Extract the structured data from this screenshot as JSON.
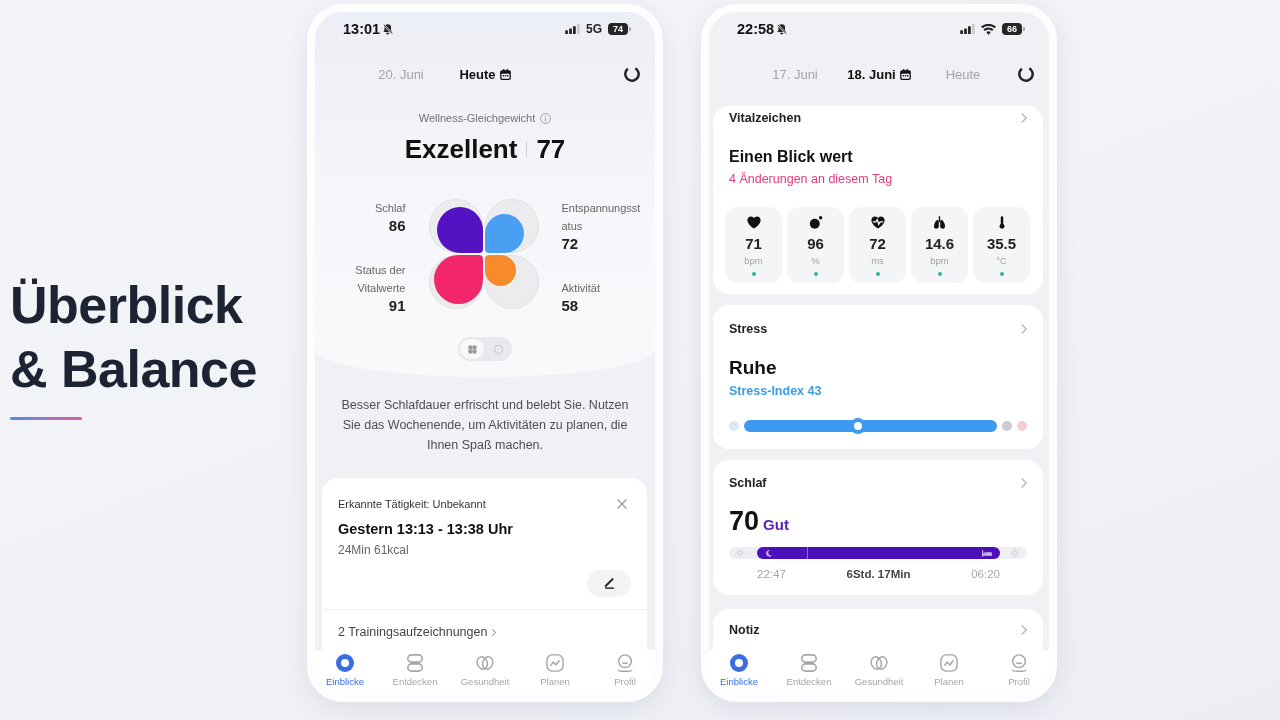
{
  "headline": "Überblick & Balance",
  "phones": [
    {
      "kind": "wellness",
      "status_bar": {
        "time": "13:01",
        "silent": true,
        "network": "5G",
        "battery": "74"
      },
      "dates": [
        {
          "label": "20. Juni",
          "selected": false
        },
        {
          "label": "Heute",
          "selected": true
        }
      ],
      "wellness": {
        "title": "Wellness-Gleichgewicht",
        "rating": "Exzellent",
        "score": "77",
        "quadrants": [
          {
            "label": "Schlaf",
            "value": "86",
            "level": 0.86,
            "color": "#5512c2"
          },
          {
            "label": "Entspannungsstatus",
            "value": "72",
            "level": 0.72,
            "color": "#4a9ff2"
          },
          {
            "label": "Status der Vitalwerte",
            "value": "91",
            "level": 0.91,
            "color": "#f2276b"
          },
          {
            "label": "Aktivität",
            "value": "58",
            "level": 0.58,
            "color": "#f78a2a"
          }
        ],
        "view_toggle": [
          {
            "kind": "clover",
            "selected": true
          },
          {
            "kind": "circle",
            "selected": false
          }
        ]
      },
      "message": "Besser Schlafdauer erfrischt und belebt Sie. Nutzen Sie das Wochenende, um Aktivitäten zu planen, die Ihnen Spaß machen.",
      "activity_card": {
        "heading": "Erkannte Tätigkeit: Unbekannt",
        "title": "Gestern 13:13 - 13:38 Uhr",
        "details": "24Min 61kcal",
        "link": "2 Trainingsaufzeichnungen"
      },
      "nav": [
        {
          "label": "Einblicke",
          "selected": true
        },
        {
          "label": "Entdecken",
          "selected": false
        },
        {
          "label": "Gesundheit",
          "selected": false
        },
        {
          "label": "Planen",
          "selected": false
        },
        {
          "label": "Profil",
          "selected": false
        }
      ]
    },
    {
      "kind": "dashboard",
      "status_bar": {
        "time": "22:58",
        "silent": true,
        "wifi": true,
        "battery": "66"
      },
      "dates": [
        {
          "label": "17. Juni",
          "selected": false
        },
        {
          "label": "18. Juni",
          "selected": true
        },
        {
          "label": "Heute",
          "selected": false
        }
      ],
      "cards": [
        {
          "kind": "vitals",
          "title": "Vitalzeichen",
          "headline": "Einen Blick wert",
          "subtitle": "4 Änderungen an diesem Tag",
          "tiles": [
            {
              "kind": "heart",
              "value": "71",
              "unit": "bpm",
              "color": "#2bb8a3"
            },
            {
              "kind": "oxygen",
              "value": "96",
              "unit": "%",
              "color": "#2bb8a3"
            },
            {
              "kind": "hrv",
              "value": "72",
              "unit": "ms",
              "color": "#2bb8a3"
            },
            {
              "kind": "lungs",
              "value": "14.6",
              "unit": "bpm",
              "color": "#2bb8a3"
            },
            {
              "kind": "temperature",
              "value": "35.5",
              "unit": "°C",
              "color": "#2bb8a3"
            }
          ]
        },
        {
          "kind": "stress",
          "title": "Stress",
          "headline": "Ruhe",
          "subtitle": "Stress-Index 43",
          "level": 0.45
        },
        {
          "kind": "sleep",
          "title": "Schlaf",
          "score": "70",
          "rating": "Gut",
          "start": "22:47",
          "duration": "6Std. 17Min",
          "end": "06:20"
        },
        {
          "kind": "note",
          "title": "Notiz"
        }
      ],
      "nav": [
        {
          "label": "Einblicke",
          "selected": true
        },
        {
          "label": "Entdecken",
          "selected": false
        },
        {
          "label": "Gesundheit",
          "selected": false
        },
        {
          "label": "Planen",
          "selected": false
        },
        {
          "label": "Profil",
          "selected": false
        }
      ]
    }
  ]
}
